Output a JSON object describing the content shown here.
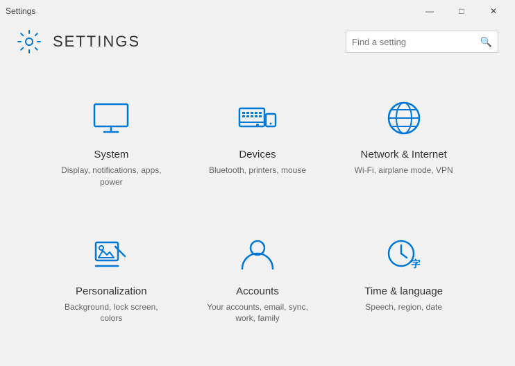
{
  "titlebar": {
    "title": "Settings",
    "minimize": "—",
    "maximize": "□",
    "close": "✕"
  },
  "header": {
    "title": "SETTINGS",
    "search_placeholder": "Find a setting"
  },
  "items": [
    {
      "id": "system",
      "name": "System",
      "description": "Display, notifications, apps, power",
      "icon": "system"
    },
    {
      "id": "devices",
      "name": "Devices",
      "description": "Bluetooth, printers, mouse",
      "icon": "devices"
    },
    {
      "id": "network",
      "name": "Network & Internet",
      "description": "Wi-Fi, airplane mode, VPN",
      "icon": "network"
    },
    {
      "id": "personalization",
      "name": "Personalization",
      "description": "Background, lock screen, colors",
      "icon": "personalization"
    },
    {
      "id": "accounts",
      "name": "Accounts",
      "description": "Your accounts, email, sync, work, family",
      "icon": "accounts"
    },
    {
      "id": "time",
      "name": "Time & language",
      "description": "Speech, region, date",
      "icon": "time"
    }
  ]
}
